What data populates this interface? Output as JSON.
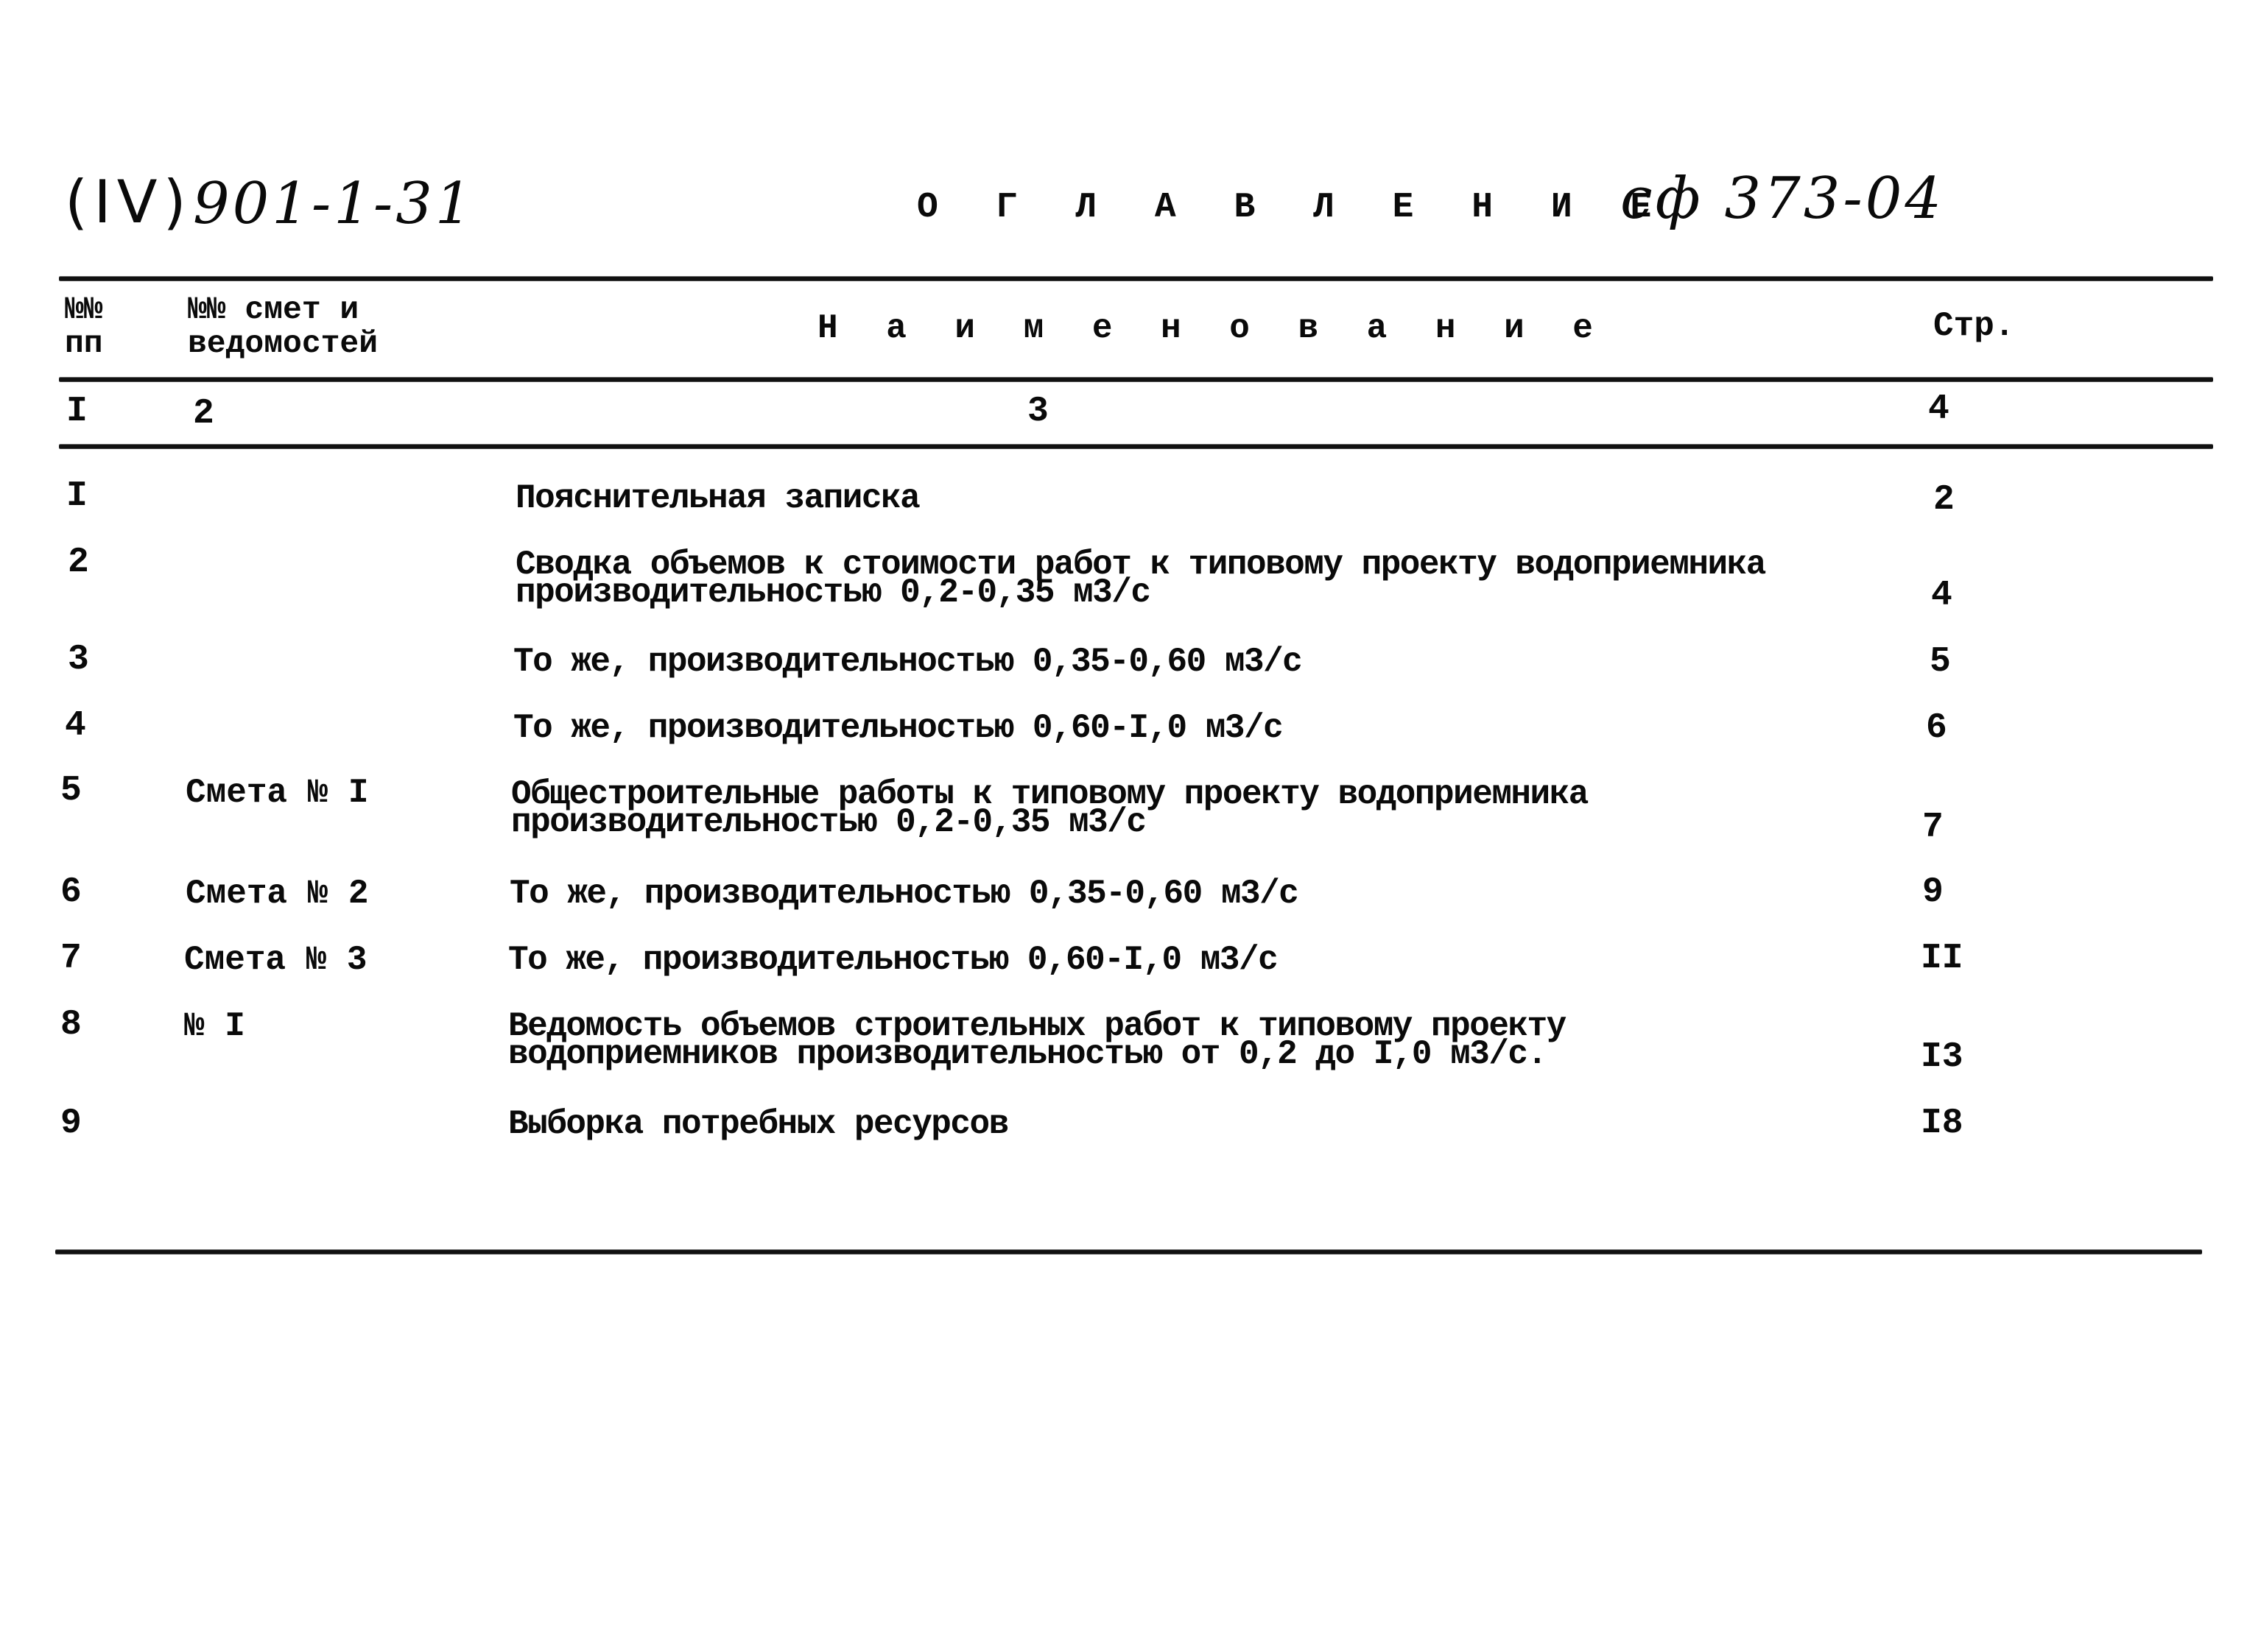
{
  "header": {
    "volume_mark": "(IV)",
    "project_code": "901-1-31",
    "title": "О Г Л А В Л Е Н И Е",
    "album_code": "сф 373-04"
  },
  "table": {
    "columns": [
      {
        "header_line1": "№№",
        "header_line2": "пп",
        "index": "I"
      },
      {
        "header_line1": "№№ смет и",
        "header_line2": "ведомостей",
        "index": "2"
      },
      {
        "header_line1": "Н а и м е н о в а н и е",
        "header_line2": "",
        "index": "3"
      },
      {
        "header_line1": "Стр.",
        "header_line2": "",
        "index": "4"
      }
    ],
    "rows": [
      {
        "no": "I",
        "estimate": "",
        "name_line1": "Пояснительная записка",
        "name_line2": "",
        "page": "2"
      },
      {
        "no": "2",
        "estimate": "",
        "name_line1": "Сводка объемов к стоимости работ к типовому проекту водоприемника",
        "name_line2": "производительностью 0,2-0,35 м3/с",
        "page": "4"
      },
      {
        "no": "3",
        "estimate": "",
        "name_line1": "То же, производительностью 0,35-0,60 м3/с",
        "name_line2": "",
        "page": "5"
      },
      {
        "no": "4",
        "estimate": "",
        "name_line1": "То же, производительностью 0,60-I,0 м3/с",
        "name_line2": "",
        "page": "6"
      },
      {
        "no": "5",
        "estimate": "Смета № I",
        "name_line1": "Общестроительные работы к типовому проекту водоприемника",
        "name_line2": "производительностью 0,2-0,35 м3/с",
        "page": "7"
      },
      {
        "no": "6",
        "estimate": "Смета № 2",
        "name_line1": "То же, производительностью 0,35-0,60 м3/с",
        "name_line2": "",
        "page": "9"
      },
      {
        "no": "7",
        "estimate": "Смета № 3",
        "name_line1": "То же, производительностью 0,60-I,0 м3/с",
        "name_line2": "",
        "page": "II"
      },
      {
        "no": "8",
        "estimate": "№ I",
        "name_line1": "Ведомость объемов строительных работ к типовому проекту",
        "name_line2": "водоприемников производительностью от 0,2 до I,0 м3/с.",
        "page": "I3"
      },
      {
        "no": "9",
        "estimate": "",
        "name_line1": "Выборка потребных ресурсов",
        "name_line2": "",
        "page": "I8"
      }
    ]
  }
}
